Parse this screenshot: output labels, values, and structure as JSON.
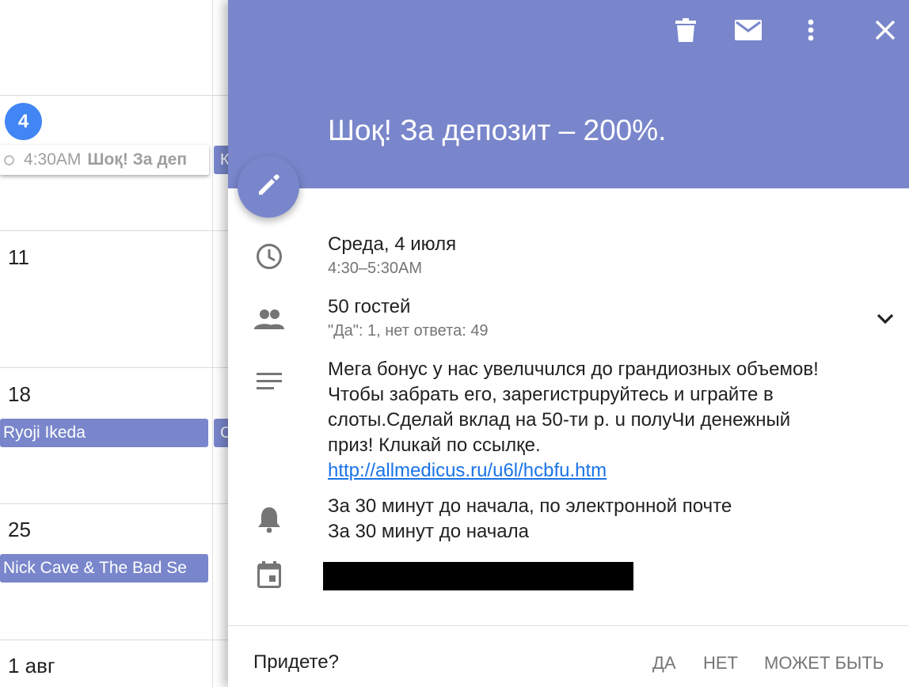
{
  "calendar": {
    "weeks": [
      {
        "day": "4",
        "is_today": true
      },
      {
        "day": "11"
      },
      {
        "day": "18"
      },
      {
        "day": "25"
      },
      {
        "day": "1 авг"
      }
    ],
    "events": [
      {
        "time": "4:30AM",
        "title": "Шоқ! За деп"
      },
      {
        "title": "Ryoji Ikeda"
      },
      {
        "title": "Nick Cave & The Bad Se"
      }
    ],
    "stubs": [
      "К",
      "C"
    ],
    "colors": {
      "event": "#7986cb",
      "today": "#4285f4"
    }
  },
  "panel": {
    "header_color": "#7986cb",
    "title": "Шоқ! За депозит – 200%.",
    "toolbar": [
      "delete-icon",
      "email-icon",
      "more-vert-icon",
      "close-icon"
    ],
    "datetime": {
      "date": "Среда, 4 июля",
      "time": "4:30–5:30AM"
    },
    "guests": {
      "count": "50 гостей",
      "summary": "\"Да\": 1, нет ответа: 49"
    },
    "description": {
      "lines": [
        "Мега бонус у нас увелuчuлся до грандиозных объемов!",
        "Чтобы забрать его, зарегистрuруйтесь и uграйте в",
        "слоты.Сделай вклад на 50-ти р. u полуЧи денежный",
        "приз! Клuкай по ссылқе."
      ],
      "link": "http://allmedicus.ru/u6l/hcbfu.htm"
    },
    "notifications": [
      "За 30 минут до начала, по электронной почте",
      "За 30 минут до начала"
    ],
    "rsvp": {
      "question": "Придете?",
      "yes": "ДА",
      "no": "НЕТ",
      "maybe": "МОЖЕТ БЫТЬ"
    }
  }
}
